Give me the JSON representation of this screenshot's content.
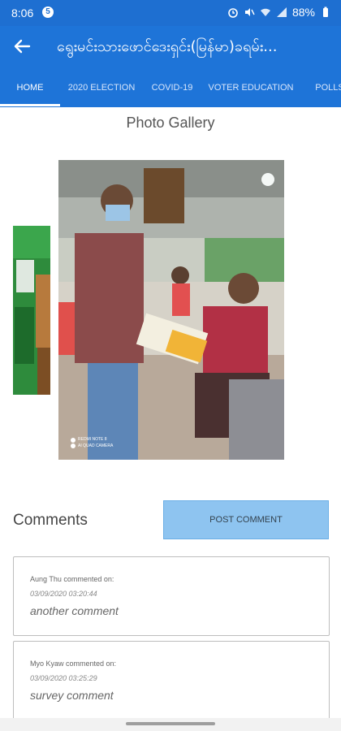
{
  "status_bar": {
    "time": "8:06",
    "notification_badge": "5",
    "battery": "88%",
    "icons": [
      "alarm-icon",
      "mute-icon",
      "wifi-icon",
      "signal-icon",
      "battery-icon"
    ]
  },
  "app_bar": {
    "title": "ရွေးမင်းသားဖောင်ဒေးရှင်း(မြန်မာ)ခရမ်း...",
    "back_icon": "arrow-left-icon"
  },
  "tabs": [
    {
      "label": "HOME",
      "active": true
    },
    {
      "label": "2020 ELECTION",
      "active": false
    },
    {
      "label": "COVID-19",
      "active": false
    },
    {
      "label": "VOTER EDUCATION",
      "active": false
    },
    {
      "label": "POLLS",
      "active": false
    }
  ],
  "gallery": {
    "title": "Photo Gallery",
    "watermark_line1": "REDMI NOTE 8",
    "watermark_line2": "AI QUAD CAMERA"
  },
  "comments": {
    "heading": "Comments",
    "post_button": "POST COMMENT",
    "items": [
      {
        "author": "Aung Thu commented on:",
        "date": "03/09/2020 03:20:44",
        "text": "another comment"
      },
      {
        "author": "Myo Kyaw commented on:",
        "date": "03/09/2020 03:25:29",
        "text": "survey comment"
      }
    ]
  },
  "colors": {
    "app_bar": "#1e74d8",
    "status_bar": "#1e6fd1",
    "post_button": "#8ec4f0"
  }
}
